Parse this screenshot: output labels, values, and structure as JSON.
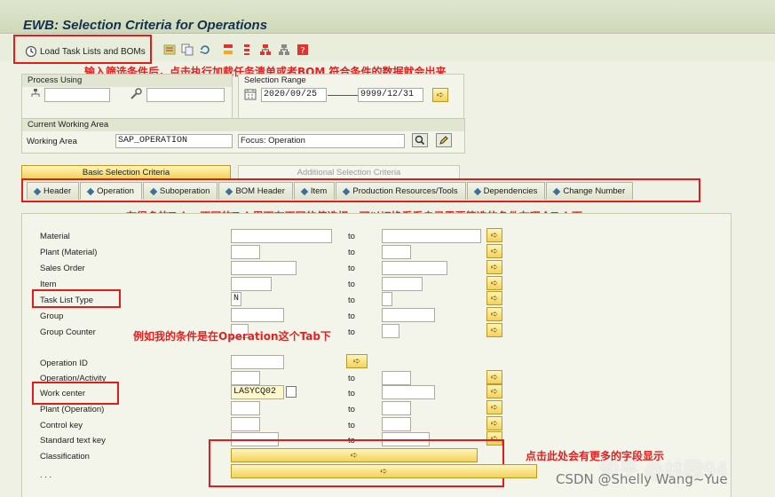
{
  "window": {
    "title": "EWB: Selection Criteria for Operations"
  },
  "toolbar": {
    "load_label": "Load Task Lists and BOMs"
  },
  "annotations": {
    "load_hint": "输入筛选条件后，点击执行加载任务清单或者BOM 符合条件的数据就会出来",
    "tab_hint": "有很多的Tab，不同的Tab里面有不同的值选择，可以切换看看自己需要筛选的条件在哪个Tab下",
    "operation_hint": "例如我的条件是在Operation这个Tab下",
    "more_fields_hint": "点击此处会有更多的字段显示"
  },
  "process_using": {
    "title": "Process Using"
  },
  "selection_range": {
    "title": "Selection Range",
    "from": "2020/09/25",
    "to": "9999/12/31"
  },
  "working_area": {
    "title": "Current Working Area",
    "label": "Working Area",
    "value": "SAP_OPERATION",
    "focus": "Focus: Operation"
  },
  "criteria_tabs": {
    "basic": "Basic Selection Criteria",
    "additional": "Additional Selection Criteria"
  },
  "tabs": [
    {
      "label": "Header"
    },
    {
      "label": "Operation"
    },
    {
      "label": "Suboperation"
    },
    {
      "label": "BOM Header"
    },
    {
      "label": "Item"
    },
    {
      "label": "Production Resources/Tools"
    },
    {
      "label": "Dependencies"
    },
    {
      "label": "Change Number"
    }
  ],
  "fields": {
    "to_label": "to",
    "material": "Material",
    "plant_material": "Plant (Material)",
    "sales_order": "Sales Order",
    "item": "Item",
    "task_list_type": "Task List Type",
    "task_list_type_value": "N",
    "group": "Group",
    "group_counter": "Group Counter",
    "operation_id": "Operation ID",
    "operation_activity": "Operation/Activity",
    "work_center": "Work center",
    "work_center_value": "LASYCQ02",
    "plant_operation": "Plant (Operation)",
    "control_key": "Control key",
    "standard_text_key": "Standard text key",
    "classification": "Classification",
    "more": ". . ."
  },
  "watermark": {
    "zhihu": "知乎 @林园94",
    "csdn": "CSDN @Shelly Wang~Yue"
  },
  "colors": {
    "annotation_red": "#e02222",
    "accent_blue": "#12314f",
    "select_yellow": "#f3d25c"
  }
}
